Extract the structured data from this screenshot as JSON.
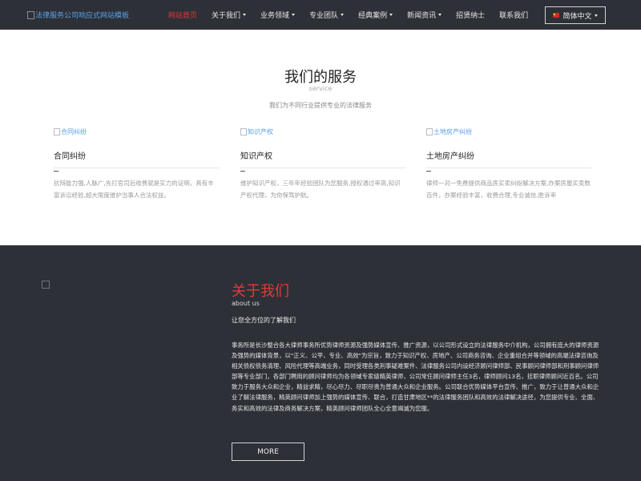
{
  "header": {
    "logo_alt": "法律服务公司响应式网站模板",
    "nav": [
      {
        "label": "网站首页",
        "active": true,
        "dropdown": false
      },
      {
        "label": "关于我们",
        "active": false,
        "dropdown": true
      },
      {
        "label": "业务领域",
        "active": false,
        "dropdown": true
      },
      {
        "label": "专业团队",
        "active": false,
        "dropdown": true
      },
      {
        "label": "经典案例",
        "active": false,
        "dropdown": true
      },
      {
        "label": "新闻资讯",
        "active": false,
        "dropdown": true
      },
      {
        "label": "招贤纳士",
        "active": false,
        "dropdown": false
      },
      {
        "label": "联系我们",
        "active": false,
        "dropdown": false
      }
    ],
    "language": "简体中文"
  },
  "services": {
    "title": "我们的服务",
    "subtitle": "service",
    "description": "我们为不同行业提供专业的法律服务",
    "cards": [
      {
        "image_alt": "合同纠纷",
        "name": "合同纠纷",
        "text": "抗辩能力强,人脉广,先打官司后收费就是实力的证明，具有丰富诉讼经验,超大限度维护当事人合法权益。"
      },
      {
        "image_alt": "知识产权",
        "name": "知识产权",
        "text": "维护知识产权，三年年经验团队为您服务,授权通过率高,知识产权代理，为你保驾护航。"
      },
      {
        "image_alt": "土地房产纠纷",
        "name": "土地房产纠纷",
        "text": "律师一对一免费提供商品房买卖纠纷解决方案,办案房屋买卖数百件，办案经验丰富，收费合理,专业诚信,胜诉率"
      }
    ]
  },
  "about": {
    "title": "关于我们",
    "subtitle_en": "about us",
    "tagline": "让您全方位的了解我们",
    "body": "事务所是长沙整合各大律师事务所优势律师资源及强势媒体宣传、推广资源，以公司形式设立的法律服务中介机构，公司拥有庞大的律师资源及强势的媒体背景，以\"正义、公平、专业、高效\"为宗旨，致力于知识产权、房地产、公司商务咨询、企业重组合并等领域的高端法律咨询及相关债权债务清理、风险代理等高端业务，同时受理各类刑事疑难案件、法律服务公司内设经济顾问律师部、民事顾问律师部和刑事顾问律师部等专业部门，各部门聘用的顾问律师均为各领域专家级精英律师，公司常任顾问律师主任3名，律师顾问13名，挂职律师顾问近百名。公司致力于服务大众和企业，精益求精，尽心尽力、尽职尽责为普通大众和企业服务。公司联合优势媒体平台宣传、推广，致力于让普通大众和企业了解法律服务，精英顾问律师加上强势的媒体宣传、联合，打造甘肃地区**的法律服务团队和高效的法律解决途径，为您提供专业、全面、务实和高效的法律及商务解决方案，精英顾问律师团队全心全意竭诚为您服。",
    "more_label": "MORE"
  },
  "colors": {
    "header_bg": "#2d3037",
    "accent_red": "#e2393b",
    "link_blue": "#5aa0e6"
  }
}
